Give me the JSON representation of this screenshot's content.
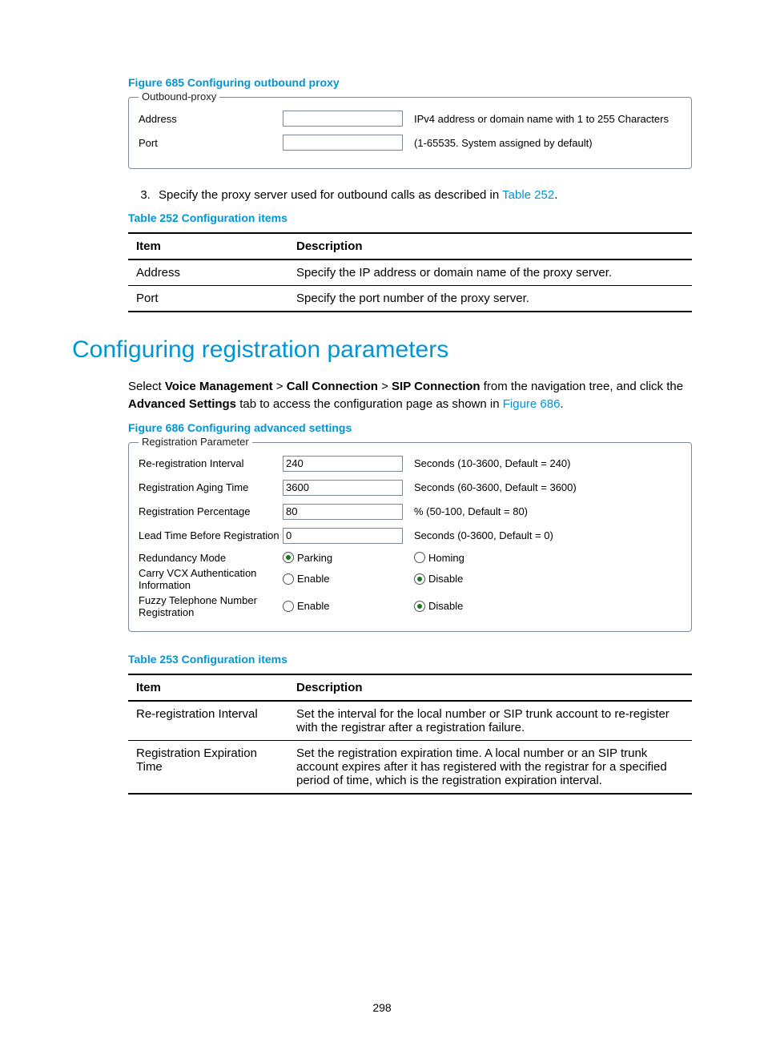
{
  "figure685": {
    "title": "Figure 685 Configuring outbound proxy",
    "legend": "Outbound-proxy",
    "rows": [
      {
        "label": "Address",
        "value": "",
        "hint": "IPv4 address or domain name with 1 to 255 Characters"
      },
      {
        "label": "Port",
        "value": "",
        "hint": "(1-65535. System assigned by default)"
      }
    ]
  },
  "step3": {
    "num": "3.",
    "text_before": "Specify the proxy server used for outbound calls as described in ",
    "link": "Table 252",
    "text_after": "."
  },
  "table252": {
    "title": "Table 252 Configuration items",
    "headers": {
      "item": "Item",
      "desc": "Description"
    },
    "rows": [
      {
        "item": "Address",
        "desc": "Specify the IP address or domain name of the proxy server."
      },
      {
        "item": "Port",
        "desc": "Specify the port number of the proxy server."
      }
    ]
  },
  "section_title": "Configuring registration parameters",
  "para1": {
    "p1": "Select ",
    "b1": "Voice Management",
    "sep": " > ",
    "b2": "Call Connection",
    "b3": "SIP Connection",
    "p2": " from the navigation tree, and click the ",
    "b4": "Advanced Settings",
    "p3": " tab to access the configuration page as shown in ",
    "link": "Figure 686",
    "p4": "."
  },
  "figure686": {
    "title": "Figure 686 Configuring advanced settings",
    "legend": "Registration Parameter",
    "text_rows": [
      {
        "label": "Re-registration Interval",
        "value": "240",
        "hint": "Seconds (10-3600, Default = 240)"
      },
      {
        "label": "Registration Aging Time",
        "value": "3600",
        "hint": "Seconds (60-3600, Default = 3600)"
      },
      {
        "label": "Registration Percentage",
        "value": "80",
        "hint": "% (50-100, Default = 80)"
      },
      {
        "label": "Lead Time Before Registration",
        "value": "0",
        "hint": "Seconds (0-3600, Default = 0)"
      }
    ],
    "radio_rows": [
      {
        "label": "Redundancy Mode",
        "opt1": "Parking",
        "opt2": "Homing",
        "selected": 0
      },
      {
        "label": "Carry VCX Authentication Information",
        "opt1": "Enable",
        "opt2": "Disable",
        "selected": 1
      },
      {
        "label": "Fuzzy Telephone Number Registration",
        "opt1": "Enable",
        "opt2": "Disable",
        "selected": 1
      }
    ]
  },
  "table253": {
    "title": "Table 253 Configuration items",
    "headers": {
      "item": "Item",
      "desc": "Description"
    },
    "rows": [
      {
        "item": "Re-registration Interval",
        "desc": "Set the interval for the local number or SIP trunk account to re-register with the registrar after a registration failure."
      },
      {
        "item": "Registration Expiration Time",
        "desc": "Set the registration expiration time. A local number or an SIP trunk account expires after it has registered with the registrar for a specified period of time, which is the registration expiration interval."
      }
    ]
  },
  "page_number": "298"
}
